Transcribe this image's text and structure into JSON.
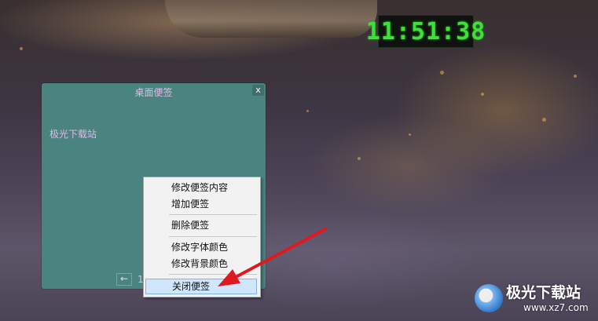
{
  "clock": {
    "time": "11:51:38"
  },
  "note_window": {
    "title": "桌面便签",
    "close_label": "x",
    "content": "极光下载站",
    "prev_label": "←",
    "page_number": "1"
  },
  "context_menu": {
    "items": [
      {
        "label": "修改便签内容"
      },
      {
        "label": "增加便签"
      },
      {
        "label": "删除便签"
      },
      {
        "label": "修改字体颜色"
      },
      {
        "label": "修改背景颜色"
      },
      {
        "label": "关闭便签"
      }
    ],
    "highlighted_item": "关闭便签"
  },
  "watermark": {
    "title": "极光下载站",
    "url": "www.xz7.com"
  },
  "colors": {
    "note_background": "#4a847f",
    "note_text": "#e4b7ea",
    "clock_digits": "#3fe03a",
    "arrow": "#e0191f",
    "menu_highlight": "#cfe6fb"
  }
}
